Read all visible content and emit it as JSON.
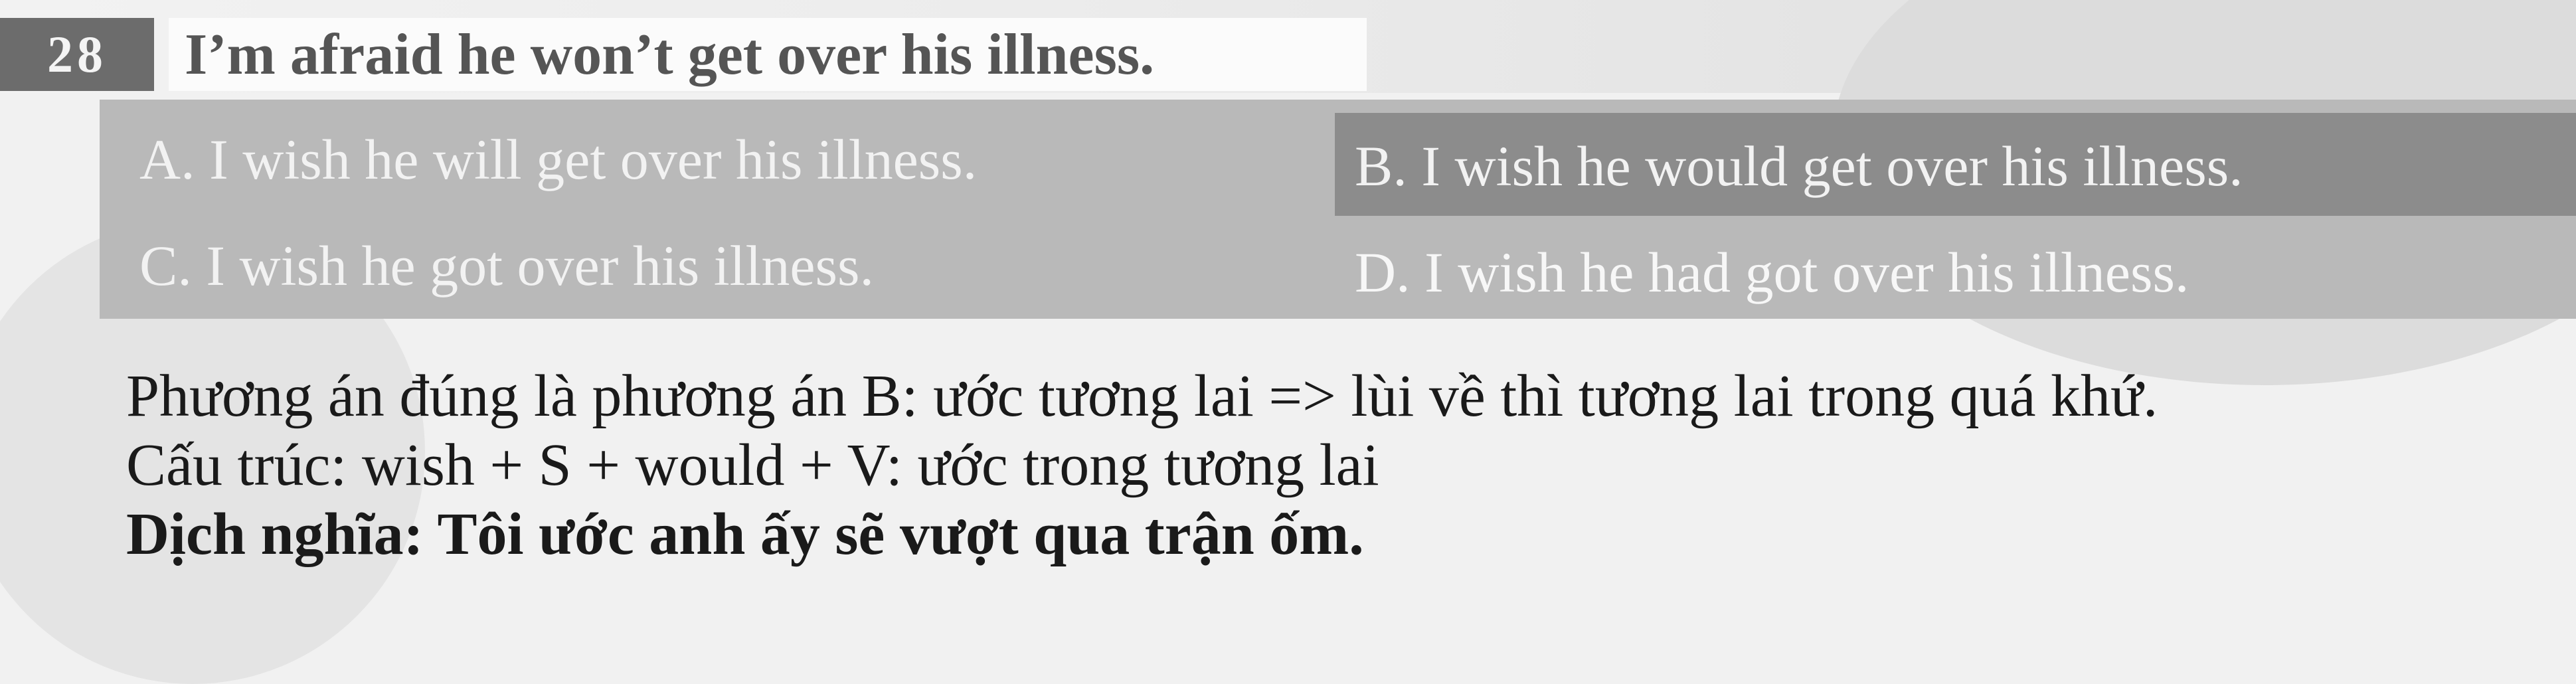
{
  "question": {
    "number": "28",
    "text": "I’m afraid he won’t get over his illness."
  },
  "options": {
    "a": "A. I wish he will get over his illness.",
    "b": "B. I wish he would get over his illness.",
    "c": "C. I wish he got over his illness.",
    "d": "D. I wish he had got over his illness."
  },
  "explanation": {
    "line1": "Phương án đúng là phương án B: ước tương lai => lùi về thì tương lai trong quá khứ.",
    "line2": "Cấu trúc: wish + S + would + V: ước trong tương lai",
    "line3": "Dịch nghĩa: Tôi ước anh ấy sẽ vượt qua trận ốm."
  },
  "colors": {
    "number_bg": "#6c6c6c",
    "options_bg": "#b9b9b9",
    "highlight_bg": "#8c8c8c",
    "text_dark": "#1a1a1a"
  }
}
